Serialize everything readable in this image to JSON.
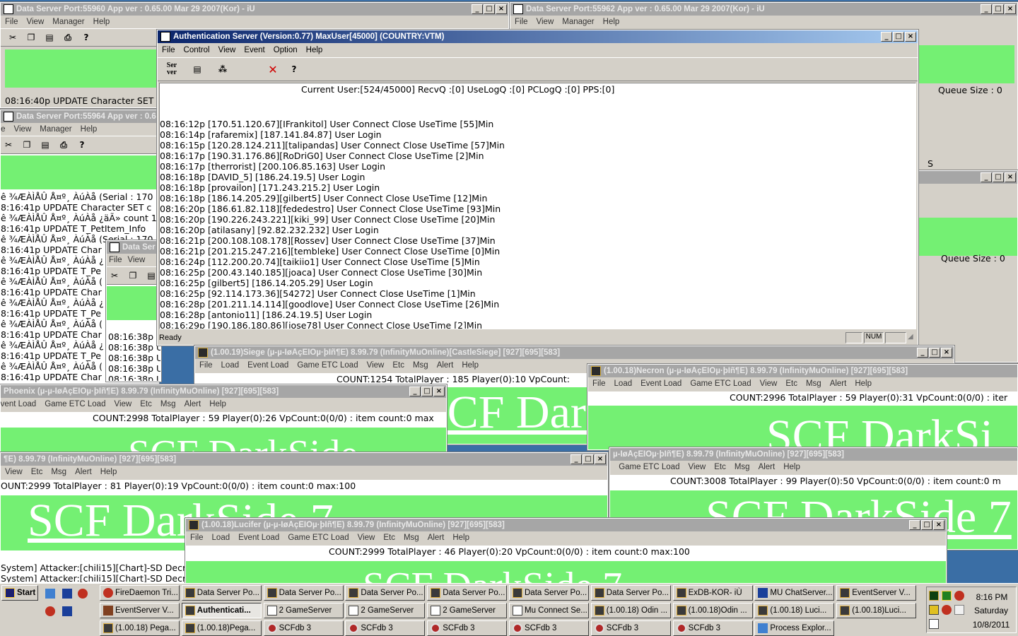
{
  "ds1": {
    "title": "Data Server Port:55960 App ver : 0.65.00 Mar 29 2007(Kor) - iÙ",
    "log": "08:16:40p UPDATE Character SET"
  },
  "ds2": {
    "title": "Data Server Port:55962 App ver : 0.65.00 Mar 29 2007(Kor) - iÙ",
    "queue": "Queue Size : 0"
  },
  "ds3": {
    "title": "Data Server Port:55964 App ver : 0.65",
    "lines": [
      "ê ¾ÆÀÌÅÛ Å¤º¸ ÀúÀå (Serial : 170",
      "8:16:41p UPDATE Character SET c",
      "ê ¾ÆÀÌÅÛ Å¤º¸ ÀúÀå ¿äÃ» count 1",
      "8:16:41p UPDATE T_PetItem_Info",
      "ê ¾ÆÀÌÅÛ Å¤º¸ ÀúÀå (Serial : 170",
      "8:16:41p UPDATE Char",
      "ê ¾ÆÀÌÅÛ Å¤º¸ ÀúÀå ¿",
      "8:16:41p UPDATE T_Pe",
      "ê ¾ÆÀÌÅÛ Å¤º¸ ÀúÀå (",
      "8:16:41p UPDATE Char",
      "ê ¾ÆÀÌÅÛ Å¤º¸ ÀúÀå ¿",
      "8:16:41p UPDATE T_Pe",
      "ê ¾ÆÀÌÅÛ Å¤º¸ ÀúÀå (",
      "8:16:41p UPDATE Char",
      "ê ¾ÆÀÌÅÛ Å¤º¸ ÀúÀå ¿",
      "8:16:41p UPDATE T_Pe",
      "ê ¾ÆÀÌÅÛ Å¤º¸ ÀúÀå (",
      "8:16:41p UPDATE Char"
    ]
  },
  "ds4": {
    "title": "Data Ser",
    "lines": [
      "08:16:38p UPDATE",
      "08:16:38p UPDATE",
      "08:16:38p UPDATE",
      "08:16:38p UPDATE",
      "08:16:38p UPDATE"
    ]
  },
  "ds_right": {
    "queue": "Queue Size : 0",
    "fragment": "S"
  },
  "menus": {
    "file": "File",
    "view": "View",
    "manager": "Manager",
    "help": "Help",
    "control": "Control",
    "event": "Event",
    "option": "Option",
    "load": "Load",
    "event_load": "Event Load",
    "game_etc_load": "Game ETC Load",
    "etc": "Etc",
    "msg": "Msg",
    "alert": "Alert"
  },
  "auth": {
    "title": "Authentication Server (Version:0.77) MaxUser[45000] (COUNTRY:VTM)",
    "toolbar_server": "Ser ver",
    "status_line": "Current User:[524/45000] RecvQ :[0] UseLogQ :[0] PCLogQ :[0] PPS:[0]",
    "log": [
      "08:16:12p [170.51.120.67][IFrankitol] User Connect Close UseTime [55]Min",
      "08:16:14p [rafaremix] [187.141.84.87] User Login",
      "08:16:15p [120.28.124.211][talipandas] User Connect Close UseTime [57]Min",
      "08:16:17p [190.31.176.86][RoDriG0] User Connect Close UseTime [2]Min",
      "08:16:17p [therrorist] [200.106.85.163] User Login",
      "08:16:18p [DAVID_5] [186.24.19.5] User Login",
      "08:16:18p [provailon] [171.243.215.2] User Login",
      "08:16:18p [186.14.205.29][gilbert5] User Connect Close UseTime [12]Min",
      "08:16:20p [186.61.82.118][fededestro] User Connect Close UseTime [93]Min",
      "08:16:20p [190.226.243.221][kiki_99] User Connect Close UseTime [20]Min",
      "08:16:20p [atilasany] [92.82.232.232] User Login",
      "08:16:21p [200.108.108.178][Rossev] User Connect Close UseTime [37]Min",
      "08:16:21p [201.215.247.216][tembleke] User Connect Close UseTime [0]Min",
      "08:16:24p [112.200.20.74][taikiio1] User Connect Close UseTime [5]Min",
      "08:16:25p [200.43.140.185][joaca] User Connect Close UseTime [30]Min",
      "08:16:25p [gilbert5] [186.14.205.29] User Login",
      "08:16:25p [92.114.173.36][54272] User Connect Close UseTime [1]Min",
      "08:16:28p [201.211.14.114][goodlove] User Connect Close UseTime [26]Min",
      "08:16:28p [antonio11] [186.24.19.5] User Login",
      "08:16:29p [190.186.180.86][jose78] User Connect Close UseTime [2]Min"
    ],
    "status_ready": "Ready",
    "num": "NUM"
  },
  "gs_siege": {
    "title": "(1.00.19)Siege (µ-µ-ÍøÅçÊÎÒµ·þÎñ¶È) 8.99.79 (InfinityMuOnline)[CastleSiege] [927][695][583]",
    "count": "COUNT:1254  TotalPlayer : 185  Player(0):10 VpCount:",
    "big": "SCF  Dark"
  },
  "gs_necron": {
    "title": "(1.00.18)Necron (µ-µ-ÍøÅçÊÎÒµ·þÎñ¶È) 8.99.79 (InfinityMuOnline) [927][695][583]",
    "count": "COUNT:2996  TotalPlayer : 59  Player(0):31 VpCount:0(0/0) : iter",
    "big": "SCF  DarkSi"
  },
  "gs_phoenix": {
    "title": "Phoenix (µ-µ-ÍøÅçÊÎÒµ·þÎñ¶È) 8.99.79 (InfinityMuOnline) [927][695][583]",
    "count": "COUNT:2998  TotalPlayer : 59  Player(0):26 VpCount:0(0/0) : item count:0 max",
    "big": "SCF  DarkSide"
  },
  "gs_a": {
    "title": "¶È) 8.99.79 (InfinityMuOnline) [927][695][583]",
    "count": "OUNT:2999  TotalPlayer : 81  Player(0):19 VpCount:0(0/0) : item count:0 max:100",
    "big": "SCF   DarkSide  7",
    "sys1": "System] Attacker:[chili15][Chart]-SD Decr",
    "sys2": "System] Attacker:[chili15][Chart]-SD Decr"
  },
  "gs_b": {
    "title": "µ-ÍøÅçÊÎÒµ·þÎñ¶È) 8.99.79 (InfinityMuOnline) [927][695][583]",
    "count": "COUNT:3008  TotalPlayer : 99  Player(0):50 VpCount:0(0/0) : item count:0 m",
    "big": "SCF   DarkSide   7"
  },
  "gs_lucifer": {
    "title": "(1.00.18)Lucifer (µ-µ-ÍøÅçÊÎÒµ·þÎñ¶È) 8.99.79 (InfinityMuOnline) [927][695][583]",
    "count": "COUNT:2999  TotalPlayer : 46  Player(0):20 VpCount:0(0/0) : item count:0 max:100",
    "big": "SCF  DarkSide  7"
  },
  "taskbar": {
    "start": "Start",
    "row1": [
      "FireDaemon Tri...",
      "Data Server Po...",
      "Data Server Po...",
      "Data Server Po...",
      "Data Server Po...",
      "Data Server Po...",
      "Data Server Po...",
      "ExDB-KOR- iÙ",
      "MU ChatServer...",
      "EventServer V..."
    ],
    "row2": [
      "EventServer V...",
      "Authenticati...",
      "2 GameServer",
      "2 GameServer",
      "2 GameServer",
      "Mu Connect Se...",
      "(1.00.18) Odin ...",
      "(1.00.18)Odin ...",
      "(1.00.18) Luci...",
      "(1.00.18)Luci..."
    ],
    "row3": [
      "(1.00.18) Pega...",
      "(1.00.18)Pega...",
      "SCFdb 3",
      "SCFdb 3",
      "SCFdb 3",
      "SCFdb 3",
      "SCFdb 3",
      "SCFdb 3",
      "Process Explor..."
    ],
    "time": "8:16 PM",
    "day": "Saturday",
    "date": "10/8/2011"
  }
}
